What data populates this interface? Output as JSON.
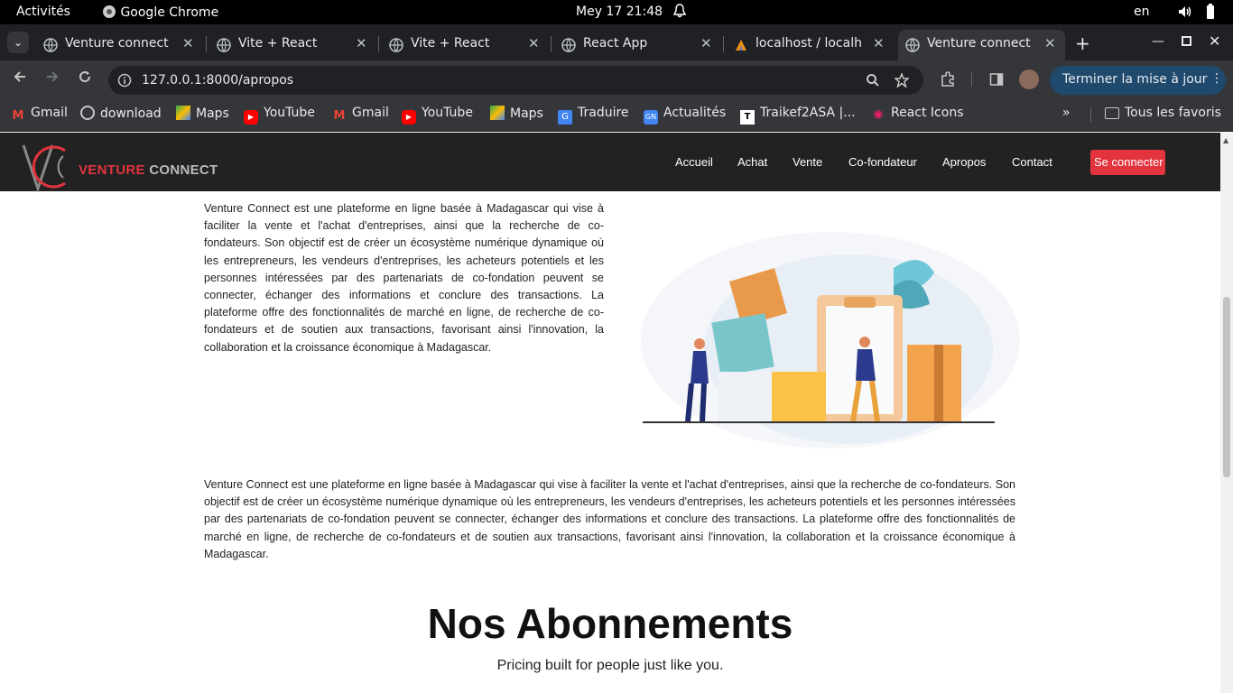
{
  "system_bar": {
    "activities": "Activités",
    "app": "Google Chrome",
    "datetime": "Mey 17  21:48",
    "lang": "en"
  },
  "tabs": [
    {
      "label": "Venture connect"
    },
    {
      "label": "Vite + React"
    },
    {
      "label": "Vite + React"
    },
    {
      "label": "React App"
    },
    {
      "label": "localhost / localhost"
    },
    {
      "label": "Venture connect"
    }
  ],
  "toolbar": {
    "url": "127.0.0.1:8000/apropos",
    "update_label": "Terminer la mise à jour"
  },
  "bookmarks": [
    {
      "label": "Gmail",
      "icon": "gmail-icon"
    },
    {
      "label": "download",
      "icon": "globe-icon"
    },
    {
      "label": "Maps",
      "icon": "maps-icon"
    },
    {
      "label": "YouTube",
      "icon": "youtube-icon"
    },
    {
      "label": "Gmail",
      "icon": "gmail-icon"
    },
    {
      "label": "YouTube",
      "icon": "youtube-icon"
    },
    {
      "label": "Maps",
      "icon": "maps-icon"
    },
    {
      "label": "Traduire",
      "icon": "translate-icon"
    },
    {
      "label": "Actualités",
      "icon": "news-icon"
    },
    {
      "label": "Traikef2ASA |...",
      "icon": "site-icon"
    },
    {
      "label": "React Icons",
      "icon": "react-icon"
    }
  ],
  "all_bookmarks": "Tous les favoris",
  "site": {
    "logo": "VENTURE CONNECT",
    "logo_parts": [
      "VENTURE",
      "CONNECT"
    ],
    "nav": [
      "Accueil",
      "Achat",
      "Vente",
      "Co-fondateur",
      "Apropos",
      "Contact"
    ],
    "login": "Se connecter",
    "accent_color": "#e3343e"
  },
  "content": {
    "para1": "Venture Connect est une plateforme en ligne basée à Madagascar qui vise à faciliter la vente et l'achat d'entreprises, ainsi que la recherche de co-fondateurs. Son objectif est de créer un écosystème numérique dynamique où les entrepreneurs, les vendeurs d'entreprises, les acheteurs potentiels et les personnes intéressées par des partenariats de co-fondation peuvent se connecter, échanger des informations et conclure des transactions. La plateforme offre des fonctionnalités de marché en ligne, de recherche de co-fondateurs et de soutien aux transactions, favorisant ainsi l'innovation, la collaboration et la croissance économique à Madagascar.",
    "para2": "Venture Connect est une plateforme en ligne basée à Madagascar qui vise à faciliter la vente et l'achat d'entreprises, ainsi que la recherche de co-fondateurs. Son objectif est de créer un écosystème numérique dynamique où les entrepreneurs, les vendeurs d'entreprises, les acheteurs potentiels et les personnes intéressées par des partenariats de co-fondation peuvent se connecter, échanger des informations et conclure des transactions. La plateforme offre des fonctionnalités de marché en ligne, de recherche de co-fondateurs et de soutien aux transactions, favorisant ainsi l'innovation, la collaboration et la croissance économique à Madagascar.",
    "heading": "Nos Abonnements",
    "subheading": "Pricing built for people just like you."
  }
}
